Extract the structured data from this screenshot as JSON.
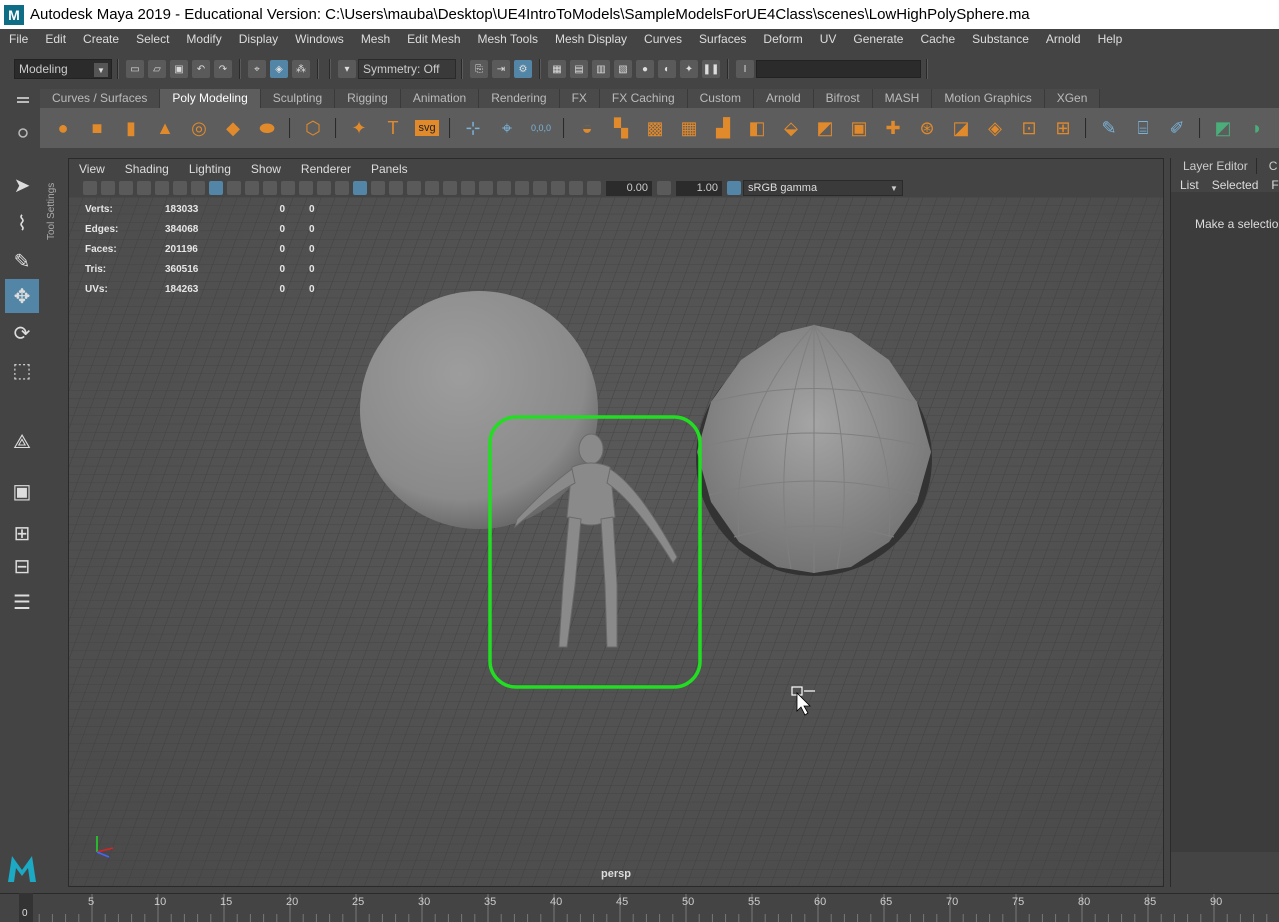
{
  "window": {
    "title": "Autodesk Maya 2019 - Educational Version: C:\\Users\\mauba\\Desktop\\UE4IntroToModels\\SampleModelsForUE4Class\\scenes\\LowHighPolySphere.ma",
    "logo_letter": "M"
  },
  "menubar": [
    "File",
    "Edit",
    "Create",
    "Select",
    "Modify",
    "Display",
    "Windows",
    "Mesh",
    "Edit Mesh",
    "Mesh Tools",
    "Mesh Display",
    "Curves",
    "Surfaces",
    "Deform",
    "UV",
    "Generate",
    "Cache",
    "Substance",
    "Arnold",
    "Help"
  ],
  "statusline": {
    "menuset": "Modeling",
    "symmetry": "Symmetry: Off"
  },
  "shelf": {
    "tabs": [
      "Curves / Surfaces",
      "Poly Modeling",
      "Sculpting",
      "Rigging",
      "Animation",
      "Rendering",
      "FX",
      "FX Caching",
      "Custom",
      "Arnold",
      "Bifrost",
      "MASH",
      "Motion Graphics",
      "XGen"
    ],
    "active_tab": "Poly Modeling",
    "text_icon": "T",
    "svg_icon": "svg",
    "sweep_icon": "0,0,0"
  },
  "tool_settings_label": "Tool Settings",
  "viewport": {
    "menus": [
      "View",
      "Shading",
      "Lighting",
      "Show",
      "Renderer",
      "Panels"
    ],
    "exposure": "0.00",
    "gamma": "1.00",
    "color_space": "sRGB gamma",
    "camera": "persp",
    "hud": [
      {
        "label": "Verts:",
        "v1": "183033",
        "v2": "0",
        "v3": "0"
      },
      {
        "label": "Edges:",
        "v1": "384068",
        "v2": "0",
        "v3": "0"
      },
      {
        "label": "Faces:",
        "v1": "201196",
        "v2": "0",
        "v3": "0"
      },
      {
        "label": "Tris:",
        "v1": "360516",
        "v2": "0",
        "v3": "0"
      },
      {
        "label": "UVs:",
        "v1": "184263",
        "v2": "0",
        "v3": "0"
      }
    ]
  },
  "rightpanel": {
    "tabs": [
      "Layer Editor",
      "C"
    ],
    "menu": [
      "List",
      "Selected",
      "Fo"
    ],
    "message": "Make a selection"
  },
  "timeslider": {
    "current_frame": "0",
    "ticks": [
      "5",
      "10",
      "15",
      "20",
      "25",
      "30",
      "35",
      "40",
      "45",
      "50",
      "55",
      "60",
      "65",
      "70",
      "75",
      "80",
      "85",
      "90"
    ]
  },
  "colors": {
    "highlight": "#22dd22",
    "active_blue": "#5285a6",
    "shelf_orange": "#e08a2c"
  }
}
